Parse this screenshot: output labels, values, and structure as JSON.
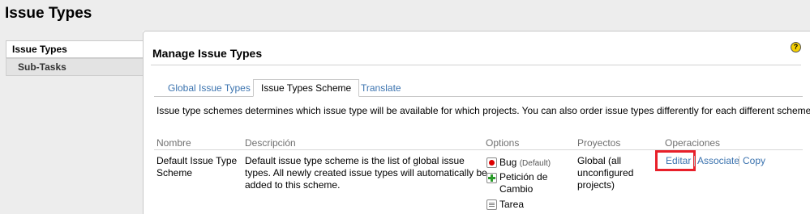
{
  "header": {
    "title": "Issue Types"
  },
  "sidebar": {
    "items": [
      {
        "label": "Issue Types"
      },
      {
        "label": "Sub-Tasks"
      }
    ]
  },
  "main": {
    "section_title": "Manage Issue Types",
    "help_glyph": "?",
    "tabs": [
      {
        "label": "Global Issue Types"
      },
      {
        "label": "Issue Types Scheme"
      },
      {
        "label": "Translate"
      }
    ],
    "intro": "Issue type schemes determines which issue type will be available for which projects. You can also order issue types differently for each different scheme."
  },
  "table": {
    "headers": [
      "Nombre",
      "Descripción",
      "Options",
      "Proyectos",
      "Operaciones"
    ],
    "row": {
      "name_line1": "Default Issue Type",
      "name_line2": "Scheme",
      "desc_line1": "Default issue type scheme is the list of global issue",
      "desc_line2": "types. All newly created issue types will automatically be",
      "desc_line3": "added to this scheme.",
      "options": [
        {
          "icon": "bug-icon",
          "label": "Bug",
          "tag": "(Default)"
        },
        {
          "icon": "change-request-icon",
          "label_line1": "Petición de",
          "label_line2": "Cambio"
        },
        {
          "icon": "task-icon",
          "label": "Tarea"
        }
      ],
      "projects_line1": "Global (all",
      "projects_line2": "unconfigured",
      "projects_line3": "projects)",
      "operations": [
        "Editar",
        "Associate",
        "Copy"
      ]
    }
  },
  "colors": {
    "link": "#3b73af",
    "highlight": "#e8202a",
    "sidebar_bg": "#ededed"
  }
}
